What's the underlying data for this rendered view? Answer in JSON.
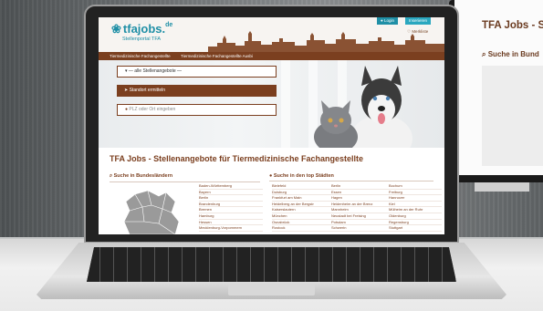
{
  "site": {
    "logo_text": "tfajobs.",
    "logo_suffix": "de",
    "tagline": "Stellenportal TFA",
    "login_label": "Login",
    "anbieten_label": "Inserieren",
    "merkliste_label": "Merkliste"
  },
  "nav": {
    "items": [
      {
        "label": "Tiermedizinische Fachangestellte"
      },
      {
        "label": "Tiermedizinische Fachangestellte Ausbi"
      }
    ]
  },
  "hero": {
    "dropdown_label": "— alle Stellenangebote —",
    "locate_label": "Standort ermitteln",
    "plz_placeholder": "PLZ oder Ort eingeben"
  },
  "main": {
    "title": "TFA Jobs - Stellenangebote für Tiermedizinische Fachangestellte",
    "bundeslaender_heading": "Suche in Bundesländern",
    "staedte_heading": "Suche in den top Städten",
    "bundeslaender": [
      "Baden-Württemberg",
      "Bayern",
      "Berlin",
      "Brandenburg",
      "Bremen",
      "Hamburg",
      "Hessen",
      "Mecklenburg-Vorpommern"
    ],
    "staedte_col1": [
      "Bielefeld",
      "Duisburg",
      "Frankfurt am Main",
      "Heidelberg an der Bergstr",
      "Kaiserslautern",
      "München",
      "Osnabrück",
      "Rostock"
    ],
    "staedte_col2": [
      "Berlin",
      "Essen",
      "Hagen",
      "Heidenheim an der Brenz",
      "Mannheim",
      "Neustadt bei Freising",
      "Potsdam",
      "Schwerin"
    ],
    "staedte_col3": [
      "Bochum",
      "Freiburg",
      "Hannover",
      "Kiel",
      "Mülheim an der Ruhr",
      "Oldenburg",
      "Regensburg",
      "Stuttgart"
    ]
  },
  "monitor": {
    "title": "TFA Jobs - S",
    "search": "Suche in Bund"
  },
  "colors": {
    "brand_brown": "#7b3f1f",
    "brand_teal": "#1f8fa6"
  }
}
